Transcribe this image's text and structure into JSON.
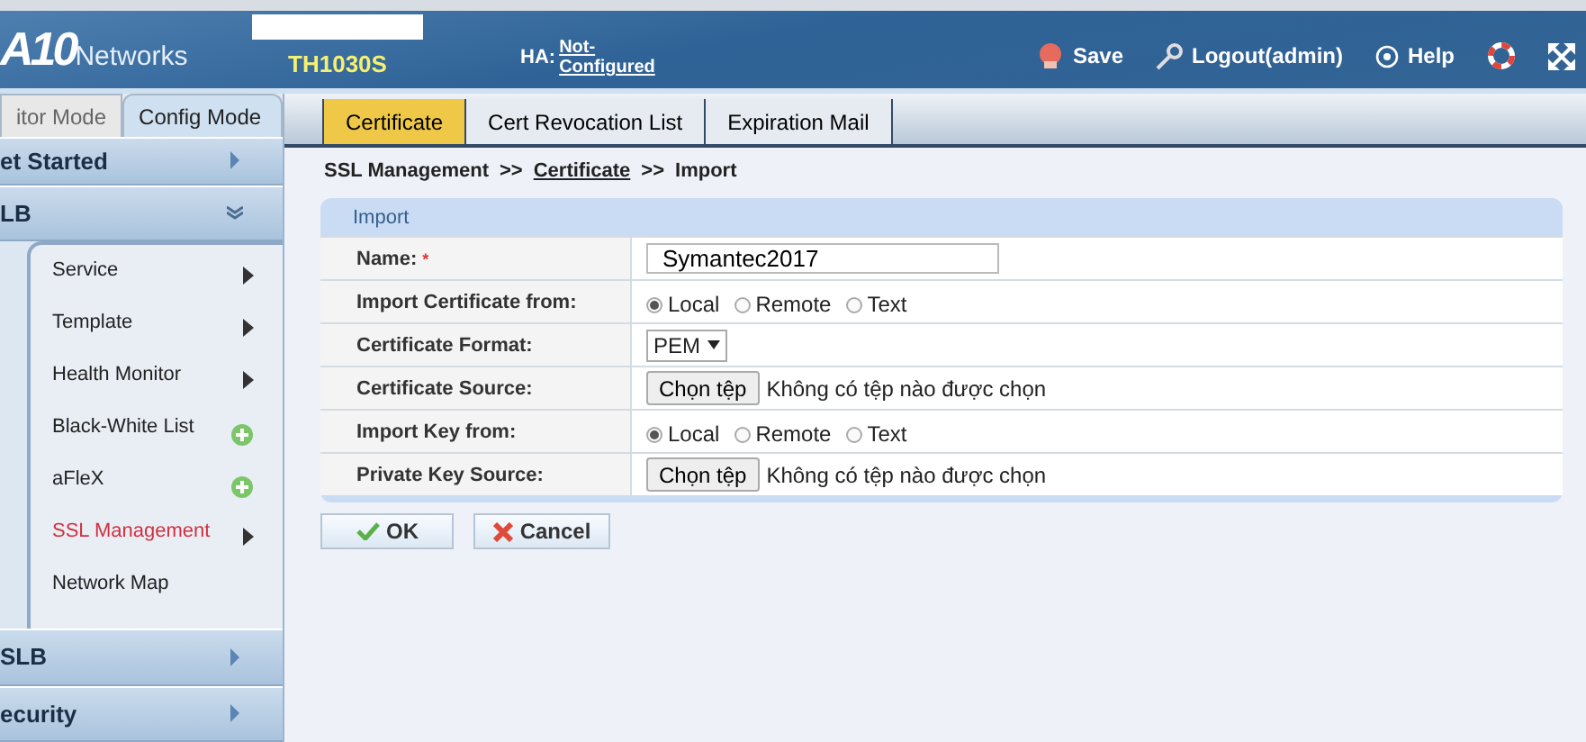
{
  "header": {
    "logo": {
      "mark": "A10",
      "word": "Networks"
    },
    "device": "TH1030S",
    "ha_label": "HA:",
    "ha_status": "Not-Configured",
    "actions": [
      {
        "kind": "save",
        "label": "Save"
      },
      {
        "kind": "logout",
        "label": "Logout(admin)"
      },
      {
        "kind": "help",
        "label": "Help"
      },
      {
        "kind": "support"
      },
      {
        "kind": "fullscreen"
      }
    ]
  },
  "mode_tabs": [
    {
      "label": "itor Mode",
      "selected": false
    },
    {
      "label": "Config Mode",
      "selected": true
    }
  ],
  "sidebar": {
    "sections": [
      {
        "label": "et Started",
        "expanded": false
      },
      {
        "label": "LB",
        "expanded": true,
        "children": [
          {
            "label": "Service",
            "kind": "submenu",
            "selected": false
          },
          {
            "label": "Template",
            "kind": "submenu",
            "selected": false
          },
          {
            "label": "Health Monitor",
            "kind": "submenu",
            "selected": false
          },
          {
            "label": "Black-White List",
            "kind": "addable",
            "selected": false
          },
          {
            "label": "aFleX",
            "kind": "addable",
            "selected": false
          },
          {
            "label": "SSL Management",
            "kind": "submenu",
            "selected": true
          },
          {
            "label": "Network Map",
            "kind": "page",
            "selected": false
          }
        ]
      },
      {
        "label": "SLB",
        "expanded": false
      },
      {
        "label": "ecurity",
        "expanded": false
      }
    ]
  },
  "tabs": [
    {
      "label": "Certificate",
      "selected": true
    },
    {
      "label": "Cert Revocation List",
      "selected": false
    },
    {
      "label": "Expiration Mail",
      "selected": false
    }
  ],
  "breadcrumb": [
    {
      "label": "SSL Management",
      "link": false
    },
    {
      "label": "Certificate",
      "link": true
    },
    {
      "label": "Import",
      "link": false
    }
  ],
  "breadcrumb_separator": ">>",
  "form": {
    "title": "Import",
    "rows": [
      {
        "kind": "text",
        "label": "Name:",
        "required_mark": "*",
        "value": "Symantec2017"
      },
      {
        "kind": "radio",
        "label": "Import Certificate from:",
        "options": [
          {
            "label": "Local",
            "selected": true
          },
          {
            "label": "Remote",
            "selected": false
          },
          {
            "label": "Text",
            "selected": false
          }
        ]
      },
      {
        "kind": "select",
        "label": "Certificate Format:",
        "value": "PEM"
      },
      {
        "kind": "file",
        "label": "Certificate Source:",
        "button": "Chọn tệp",
        "status": "Không có tệp nào được chọn"
      },
      {
        "kind": "radio",
        "label": "Import Key from:",
        "options": [
          {
            "label": "Local",
            "selected": true
          },
          {
            "label": "Remote",
            "selected": false
          },
          {
            "label": "Text",
            "selected": false
          }
        ]
      },
      {
        "kind": "file",
        "label": "Private Key Source:",
        "button": "Chọn tệp",
        "status": "Không có tệp nào được chọn"
      }
    ]
  },
  "buttons": [
    {
      "kind": "ok",
      "label": "OK"
    },
    {
      "kind": "cancel",
      "label": "Cancel"
    }
  ]
}
